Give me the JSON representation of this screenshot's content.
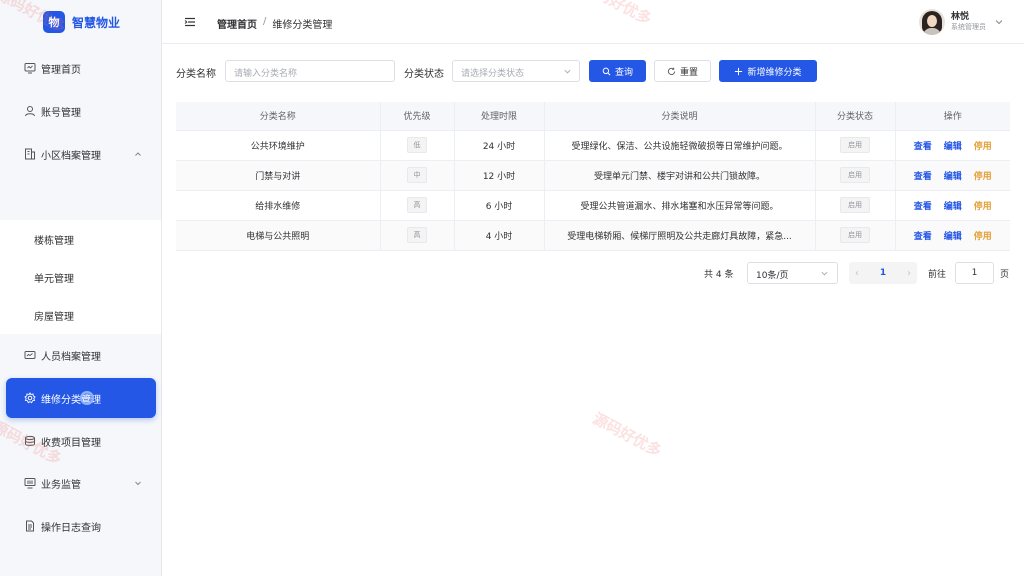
{
  "brand": {
    "logo_char": "物",
    "name": "智慧物业"
  },
  "sidebar": {
    "items": [
      {
        "label": "管理首页",
        "icon": "dashboard-icon"
      },
      {
        "label": "账号管理",
        "icon": "user-icon"
      },
      {
        "label": "小区档案管理",
        "icon": "building-icon",
        "expanded": true
      },
      {
        "label": "人员档案管理",
        "icon": "id-card-icon"
      },
      {
        "label": "维修分类管理",
        "icon": "gear-icon",
        "active": true
      },
      {
        "label": "收费项目管理",
        "icon": "database-icon"
      },
      {
        "label": "业务监管",
        "icon": "monitor-icon",
        "expanded": false
      },
      {
        "label": "操作日志查询",
        "icon": "document-icon"
      }
    ],
    "submenu": [
      "楼栋管理",
      "单元管理",
      "房屋管理"
    ]
  },
  "header": {
    "breadcrumb_home": "管理首页",
    "breadcrumb_sep": "/",
    "breadcrumb_current": "维修分类管理",
    "user_name": "林悦",
    "user_role": "系统管理员"
  },
  "filters": {
    "name_label": "分类名称",
    "name_placeholder": "请输入分类名称",
    "status_label": "分类状态",
    "status_placeholder": "请选择分类状态",
    "query_button": "查询",
    "reset_button": "重置",
    "add_button": "新增维修分类"
  },
  "table": {
    "columns": [
      "分类名称",
      "优先级",
      "处理时限",
      "分类说明",
      "分类状态",
      "操作"
    ],
    "rows": [
      {
        "name": "公共环境维护",
        "priority": "低",
        "limit": "24 小时",
        "desc": "受理绿化、保洁、公共设施轻微破损等日常维护问题。",
        "status": "启用"
      },
      {
        "name": "门禁与对讲",
        "priority": "中",
        "limit": "12 小时",
        "desc": "受理单元门禁、楼宇对讲和公共门锁故障。",
        "status": "启用"
      },
      {
        "name": "给排水维修",
        "priority": "高",
        "limit": "6 小时",
        "desc": "受理公共管道漏水、排水堵塞和水压异常等问题。",
        "status": "启用"
      },
      {
        "name": "电梯与公共照明",
        "priority": "高",
        "limit": "4 小时",
        "desc": "受理电梯轿厢、候梯厅照明及公共走廊灯具故障，紧急...",
        "status": "启用"
      }
    ],
    "actions": {
      "view": "查看",
      "edit": "编辑",
      "disable": "停用"
    }
  },
  "pagination": {
    "total": "共 4 条",
    "page_size": "10条/页",
    "current_page": "1",
    "goto_label": "前往",
    "goto_value": "1",
    "page_suffix": "页"
  },
  "watermark": "源码好优多",
  "colors": {
    "primary": "#2457e6",
    "warning": "#e6a23c"
  }
}
